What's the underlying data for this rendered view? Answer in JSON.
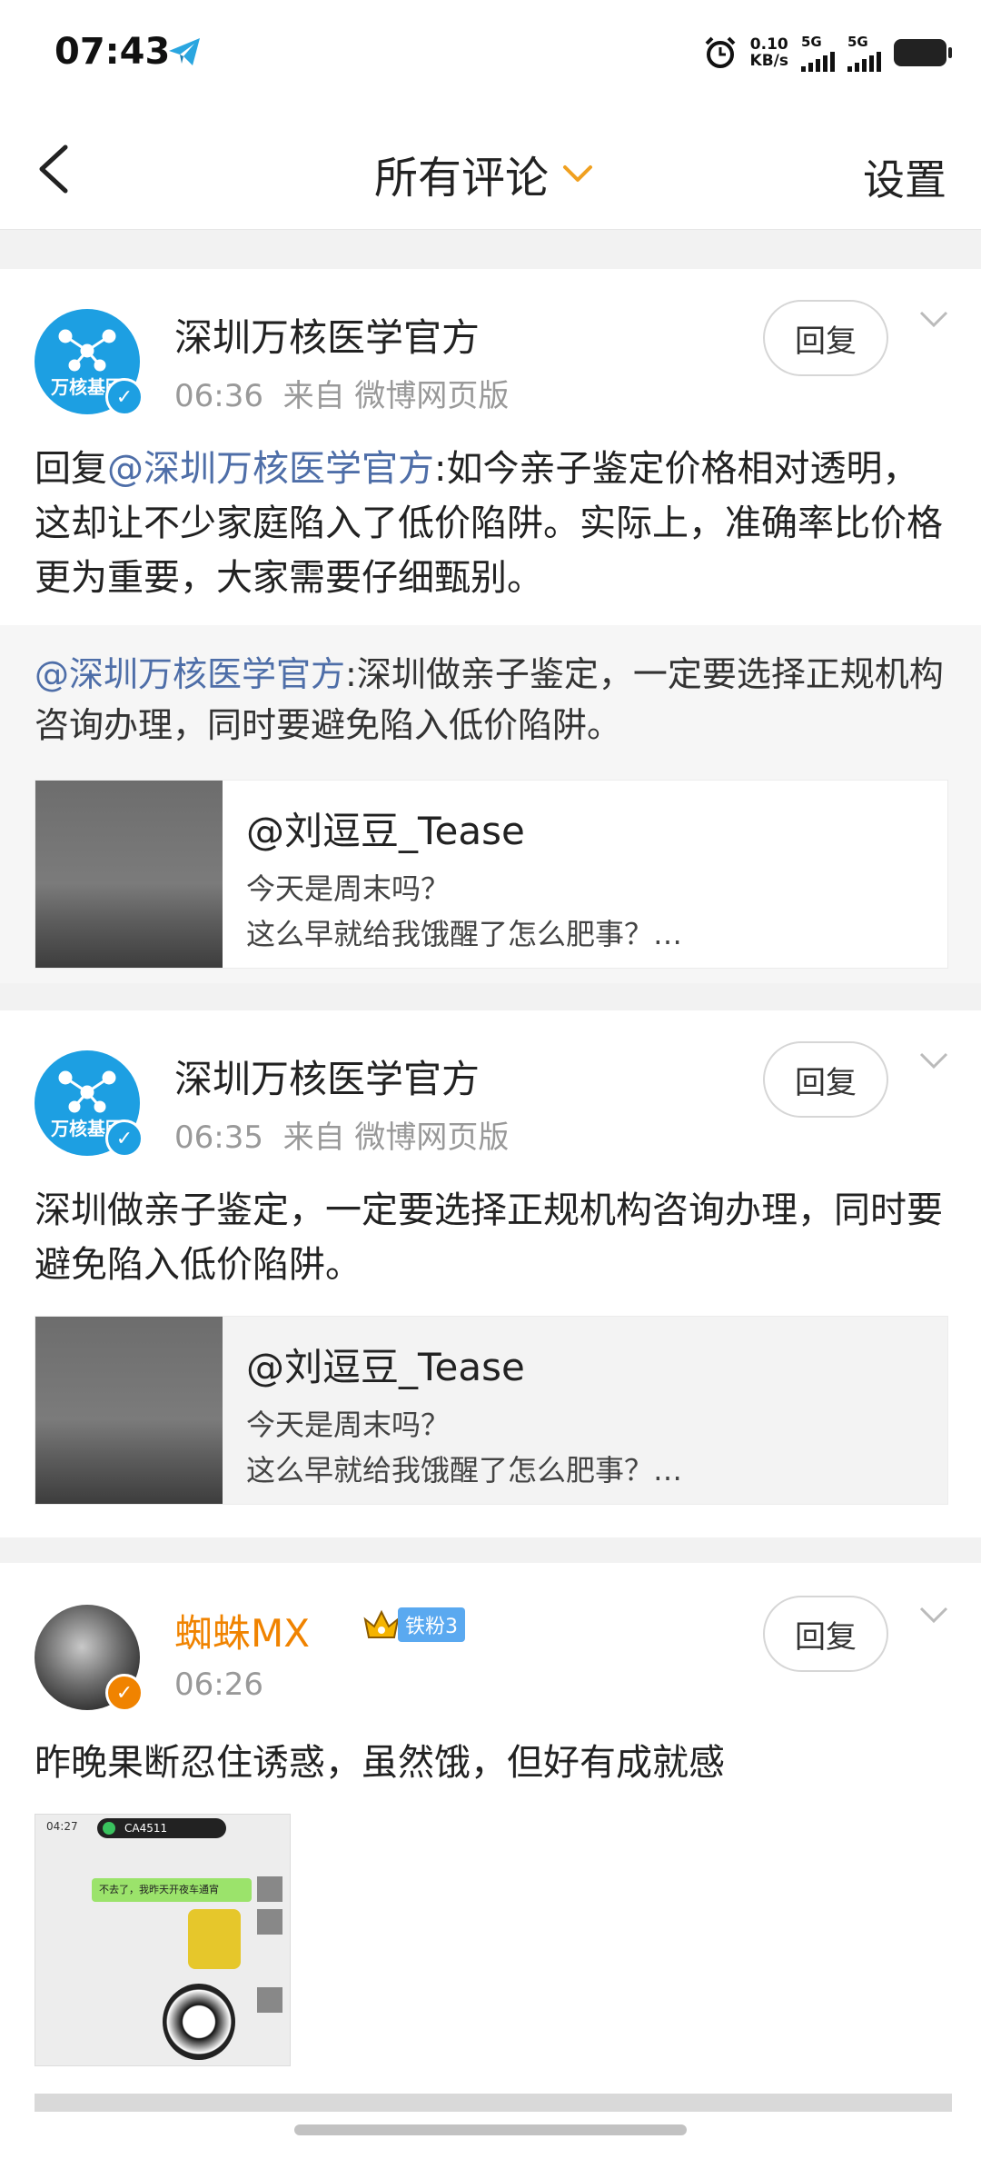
{
  "status_bar": {
    "time": "07:43",
    "net_speed_value": "0.10",
    "net_speed_unit": "KB/s",
    "sim1_label": "5G",
    "sim2_label": "5G"
  },
  "nav": {
    "title": "所有评论",
    "settings": "设置"
  },
  "comments": [
    {
      "username": "深圳万核医学官方",
      "avatar_text": "万核基因",
      "time": "06:36",
      "source": "来自 微博网页版",
      "reply_label": "回复",
      "reply_prefix": "回复",
      "mention": "@深圳万核医学官方",
      "text": ":如今亲子鉴定价格相对透明，这却让不少家庭陷入了低价陷阱。实际上，准确率比价格更为重要，大家需要仔细甄别。",
      "quote_mention": "@深圳万核医学官方",
      "quote_text": ":深圳做亲子鉴定，一定要选择正规机构咨询办理，同时要避免陷入低价陷阱。",
      "embed": {
        "title": "@刘逗豆_Tease",
        "line1": "今天是周末吗？",
        "line2": "这么早就给我饿醒了怎么肥事？…"
      }
    },
    {
      "username": "深圳万核医学官方",
      "avatar_text": "万核基因",
      "time": "06:35",
      "source": "来自 微博网页版",
      "reply_label": "回复",
      "text": "深圳做亲子鉴定，一定要选择正规机构咨询办理，同时要避免陷入低价陷阱。",
      "embed": {
        "title": "@刘逗豆_Tease",
        "line1": "今天是周末吗？",
        "line2": "这么早就给我饿醒了怎么肥事？…"
      }
    },
    {
      "username": "蜘蛛MX",
      "fan_badge": "铁粉3",
      "time": "06:26",
      "reply_label": "回复",
      "text": "昨晚果断忍住诱惑，虽然饿，但好有成就感",
      "image": {
        "time": "04:27",
        "call_label": "CA4511",
        "bubble": "不去了，我昨天开夜车通宵"
      }
    }
  ],
  "colors": {
    "accent_orange": "#f08300",
    "mention_blue": "#4e6ea8",
    "verified_blue": "#1d9fe2"
  }
}
